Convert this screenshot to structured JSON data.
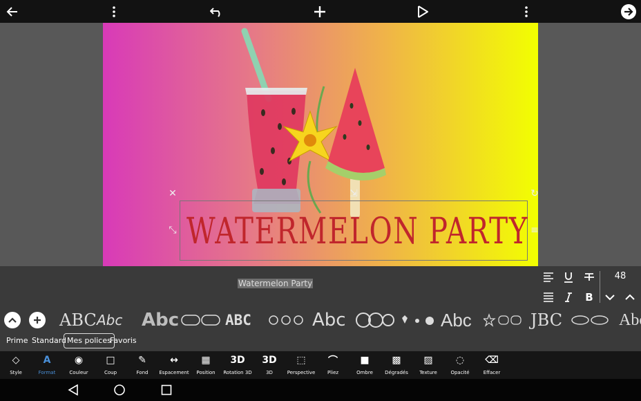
{
  "topbar": {
    "back_icon": "arrow-left-icon",
    "menu_icon": "vertical-dots-icon",
    "undo_icon": "undo-icon",
    "add_icon": "plus-icon",
    "preview_icon": "play-icon",
    "more_icon": "vertical-dots-icon",
    "next_icon": "arrow-right-circle-icon"
  },
  "canvas": {
    "title_text": "WATERMELON PARTY",
    "title_color": "#c0262c",
    "image_description": "watercolor glass of watermelon drink with straw, yellow flower and watermelon popsicle"
  },
  "text_editor": {
    "text_value": "Watermelon Party",
    "font_size": "48"
  },
  "font_samples": [
    "ABC",
    "Abc",
    "Abc",
    "ABC",
    "Abc",
    "Abc",
    "JBC",
    "Abc"
  ],
  "categories": [
    {
      "label": "Prime"
    },
    {
      "label": "Standard"
    },
    {
      "label": "Mes polices",
      "active": true
    },
    {
      "label": "Favoris"
    }
  ],
  "tools": [
    {
      "label": "Style",
      "icon": "style-icon",
      "glyph": "◇"
    },
    {
      "label": "Format",
      "icon": "format-text-icon",
      "glyph": "A",
      "active": true
    },
    {
      "label": "Couleur",
      "icon": "palette-icon",
      "glyph": "◉"
    },
    {
      "label": "Coup",
      "icon": "stroke-square-icon",
      "glyph": "□"
    },
    {
      "label": "Fond",
      "icon": "pen-icon",
      "glyph": "✎"
    },
    {
      "label": "Espacement",
      "icon": "spacing-icon",
      "glyph": "↔"
    },
    {
      "label": "Position",
      "icon": "grid-icon",
      "glyph": "▦"
    },
    {
      "label": "Rotation 3D",
      "icon": "rotation-3d-icon",
      "glyph": "3D"
    },
    {
      "label": "3D",
      "icon": "3d-icon",
      "glyph": "3D"
    },
    {
      "label": "Perspective",
      "icon": "perspective-icon",
      "glyph": "⬚"
    },
    {
      "label": "Pliez",
      "icon": "bend-icon",
      "glyph": "⌒"
    },
    {
      "label": "Ombre",
      "icon": "shadow-icon",
      "glyph": "■"
    },
    {
      "label": "Dégradés",
      "icon": "gradient-icon",
      "glyph": "▩"
    },
    {
      "label": "Texture",
      "icon": "texture-icon",
      "glyph": "▨"
    },
    {
      "label": "Opacité",
      "icon": "opacity-icon",
      "glyph": "◌"
    },
    {
      "label": "Effacer",
      "icon": "eraser-icon",
      "glyph": "⌫"
    }
  ],
  "navbar": {
    "back_icon": "nav-back-icon",
    "home_icon": "nav-home-icon",
    "recents_icon": "nav-recents-icon"
  },
  "colors": {
    "accent": "#4a90d9",
    "toolbar_bg": "#161616",
    "panel_bg": "#3a3a3a"
  }
}
